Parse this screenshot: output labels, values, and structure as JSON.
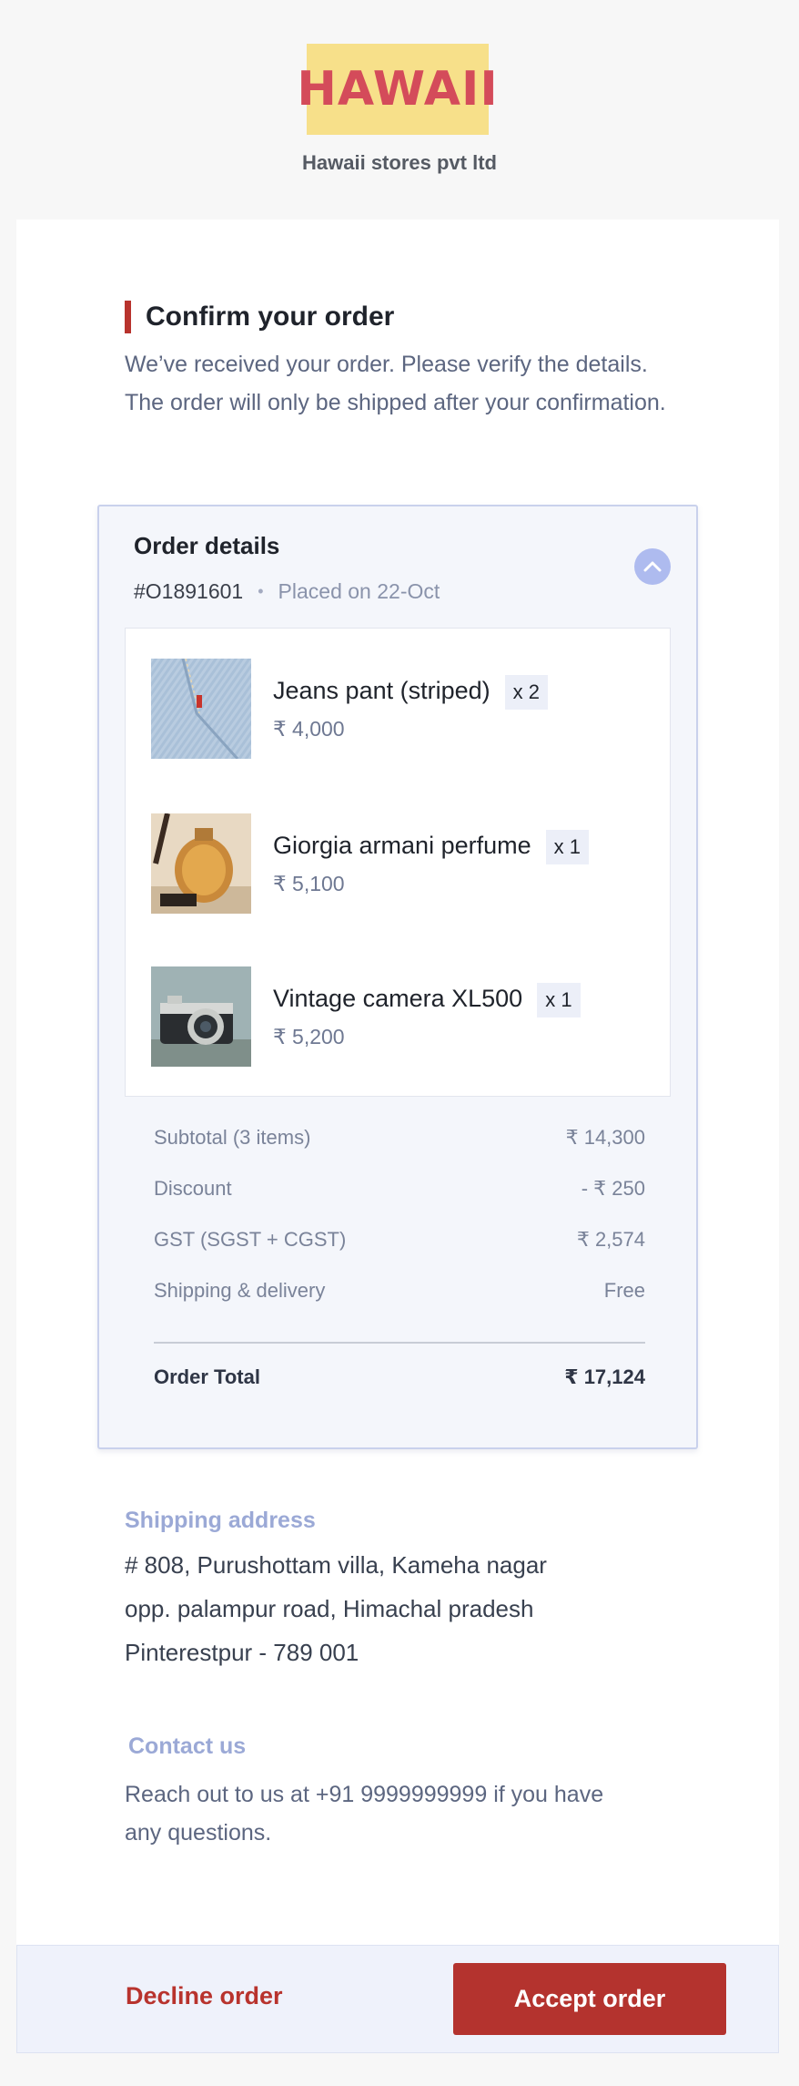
{
  "header": {
    "logo_text": "HAWAII",
    "store_name": "Hawaii stores pvt ltd",
    "logo_bg": "#f7e08a",
    "logo_color": "#d44b5a"
  },
  "confirm": {
    "title": "Confirm your order",
    "intro": "We’ve received your order. Please verify the details. The order will only be shipped after your confirmation."
  },
  "order": {
    "title": "Order details",
    "id": "#O1891601",
    "placed": "Placed on 22-Oct",
    "collapse_icon": "chevron-up-icon",
    "items": [
      {
        "name": "Jeans pant (striped)",
        "qty": "x 2",
        "price": "₹ 4,000",
        "image": "jeans-photo"
      },
      {
        "name": "Giorgia armani perfume",
        "qty": "x 1",
        "price": "₹ 5,100",
        "image": "perfume-photo"
      },
      {
        "name": "Vintage camera XL500",
        "qty": "x 1",
        "price": "₹ 5,200",
        "image": "camera-photo"
      }
    ],
    "summary": [
      {
        "label": "Subtotal (3 items)",
        "value": "₹ 14,300"
      },
      {
        "label": "Discount",
        "value": "- ₹ 250"
      },
      {
        "label": "GST (SGST + CGST)",
        "value": "₹ 2,574"
      },
      {
        "label": "Shipping & delivery",
        "value": "Free"
      }
    ],
    "total": {
      "label": "Order Total",
      "value": "₹ 17,124"
    }
  },
  "shipping": {
    "label": "Shipping address",
    "lines": [
      "# 808, Purushottam villa, Kameha nagar",
      "opp. palampur road, Himachal pradesh",
      "Pinterestpur - 789 001"
    ]
  },
  "contact": {
    "label": "Contact us",
    "text": "Reach out to us at +91 9999999999 if you have any questions."
  },
  "actions": {
    "decline": "Decline order",
    "accept": "Accept order",
    "accent": "#b4332e"
  }
}
